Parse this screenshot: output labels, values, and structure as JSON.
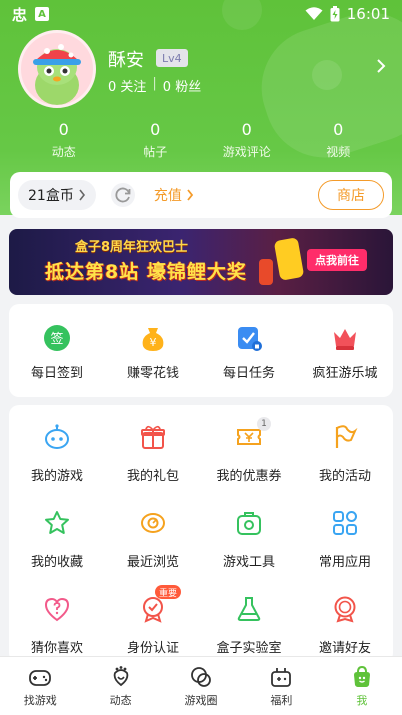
{
  "status_bar": {
    "time": "16:01",
    "app_glyph": "忠",
    "a_glyph": "A"
  },
  "profile": {
    "username": "酥安",
    "level": "Lv4",
    "following": "0 关注",
    "separator": "|",
    "followers": "0 粉丝"
  },
  "stats": [
    {
      "value": "0",
      "label": "动态"
    },
    {
      "value": "0",
      "label": "帖子"
    },
    {
      "value": "0",
      "label": "游戏评论"
    },
    {
      "value": "0",
      "label": "视频"
    }
  ],
  "coins": {
    "balance": "21盒币",
    "recharge": "充值",
    "shop": "商店"
  },
  "banner": {
    "line1": "盒子8周年狂欢巴士",
    "line2": "抵达第8站 壕锦鲤大奖",
    "cta": "点我前往"
  },
  "tasks": [
    {
      "label": "每日签到",
      "icon": "checkin-icon",
      "color": "#35c25e",
      "glyph": "签"
    },
    {
      "label": "赚零花钱",
      "icon": "money-bag-icon",
      "color": "#ffb21a",
      "glyph": "¥"
    },
    {
      "label": "每日任务",
      "icon": "task-clipboard-icon",
      "color": "#3a8cf2",
      "glyph": "✓"
    },
    {
      "label": "疯狂游乐城",
      "icon": "crown-icon",
      "color": "#f2515a",
      "glyph": "♛"
    }
  ],
  "grid": [
    [
      {
        "label": "我的游戏",
        "icon": "gamepad-robot-icon",
        "color": "#3aa5f2"
      },
      {
        "label": "我的礼包",
        "icon": "gift-icon",
        "color": "#f2544a"
      },
      {
        "label": "我的优惠券",
        "icon": "coupon-icon",
        "color": "#f5a21e",
        "badge": "1"
      },
      {
        "label": "我的活动",
        "icon": "flag-icon",
        "color": "#f5a21e"
      }
    ],
    [
      {
        "label": "我的收藏",
        "icon": "star-icon",
        "color": "#35c25e"
      },
      {
        "label": "最近浏览",
        "icon": "eye-icon",
        "color": "#f5a21e"
      },
      {
        "label": "游戏工具",
        "icon": "toolbox-icon",
        "color": "#35c25e"
      },
      {
        "label": "常用应用",
        "icon": "apps-grid-icon",
        "color": "#3aa5f2"
      }
    ],
    [
      {
        "label": "猜你喜欢",
        "icon": "question-heart-icon",
        "color": "#f25a8a"
      },
      {
        "label": "身份认证",
        "icon": "medal-icon",
        "color": "#f2544a",
        "tag": "重要"
      },
      {
        "label": "盒子实验室",
        "icon": "flask-icon",
        "color": "#35c25e"
      },
      {
        "label": "邀请好友",
        "icon": "invite-badge-icon",
        "color": "#f2544a"
      }
    ]
  ],
  "bottom_nav": [
    {
      "label": "找游戏",
      "icon": "gamepad-icon"
    },
    {
      "label": "动态",
      "icon": "footprint-icon"
    },
    {
      "label": "游戏圈",
      "icon": "circle-swirl-icon"
    },
    {
      "label": "福利",
      "icon": "gift-console-icon"
    },
    {
      "label": "我",
      "icon": "me-bag-icon",
      "active": true
    }
  ],
  "colors": {
    "brand_green": "#5fc23a",
    "accent_orange": "#f49b2a"
  }
}
